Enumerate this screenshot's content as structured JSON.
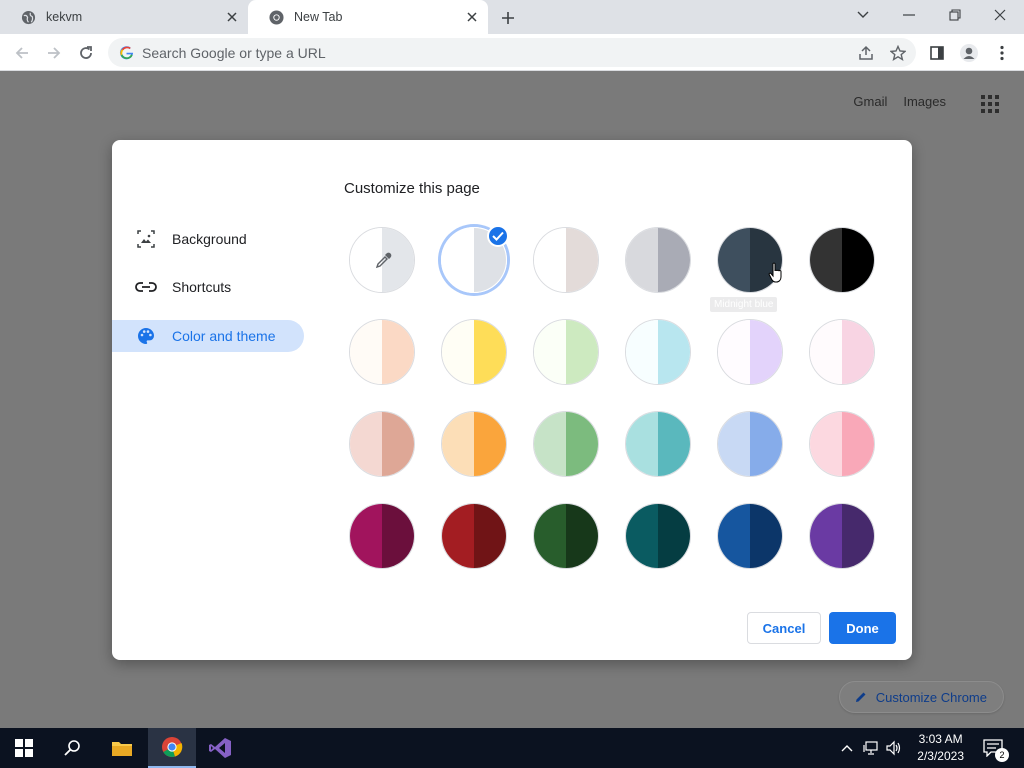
{
  "tabs": [
    {
      "title": "kekvm",
      "icon": "globe-icon"
    },
    {
      "title": "New Tab",
      "icon": "chrome-icon"
    }
  ],
  "omnibox": {
    "placeholder": "Search Google or type a URL"
  },
  "page": {
    "links": [
      "Gmail",
      "Images"
    ],
    "customize_chrome": "Customize Chrome"
  },
  "dialog": {
    "title": "Customize this page",
    "nav": [
      "Background",
      "Shortcuts",
      "Color and theme"
    ],
    "active_nav": "Color and theme",
    "tooltip": "Midnight blue",
    "cancel_label": "Cancel",
    "done_label": "Done",
    "swatches": [
      [
        {
          "l": "#ffffff",
          "r": "#e3e6ea",
          "type": "picker"
        },
        {
          "l": "#ffffff",
          "r": "#dee1e6",
          "selected": true
        },
        {
          "l": "#ffffff",
          "r": "#e3dbd9"
        },
        {
          "l": "#d8d9dd",
          "r": "#a9abb5"
        },
        {
          "l": "#3e4f5e",
          "r": "#283540"
        },
        {
          "l": "#333333",
          "r": "#000000"
        }
      ],
      [
        {
          "l": "#fffbf6",
          "r": "#fbd9c5"
        },
        {
          "l": "#fffef5",
          "r": "#fedd58"
        },
        {
          "l": "#fbfff7",
          "r": "#cdeac0"
        },
        {
          "l": "#f7feff",
          "r": "#b8e6ef"
        },
        {
          "l": "#fffcff",
          "r": "#e3d3fb"
        },
        {
          "l": "#fffbfd",
          "r": "#f8d4e3"
        }
      ],
      [
        {
          "l": "#f4d8d2",
          "r": "#dea796"
        },
        {
          "l": "#fcdeb7",
          "r": "#faa53c"
        },
        {
          "l": "#c6e3c7",
          "r": "#7cbb7e"
        },
        {
          "l": "#a9e0e0",
          "r": "#5ab8bd"
        },
        {
          "l": "#c8d9f4",
          "r": "#86acea"
        },
        {
          "l": "#fcd8e0",
          "r": "#f9a8b8"
        }
      ],
      [
        {
          "l": "#a1145d",
          "r": "#6b0f3c"
        },
        {
          "l": "#a31d22",
          "r": "#701416"
        },
        {
          "l": "#285d2c",
          "r": "#17381a"
        },
        {
          "l": "#0a5b61",
          "r": "#053d42"
        },
        {
          "l": "#16569f",
          "r": "#0c3669"
        },
        {
          "l": "#6a3aa3",
          "r": "#46296c"
        }
      ]
    ]
  },
  "taskbar": {
    "time": "3:03 AM",
    "date": "2/3/2023",
    "notifications": "2"
  }
}
